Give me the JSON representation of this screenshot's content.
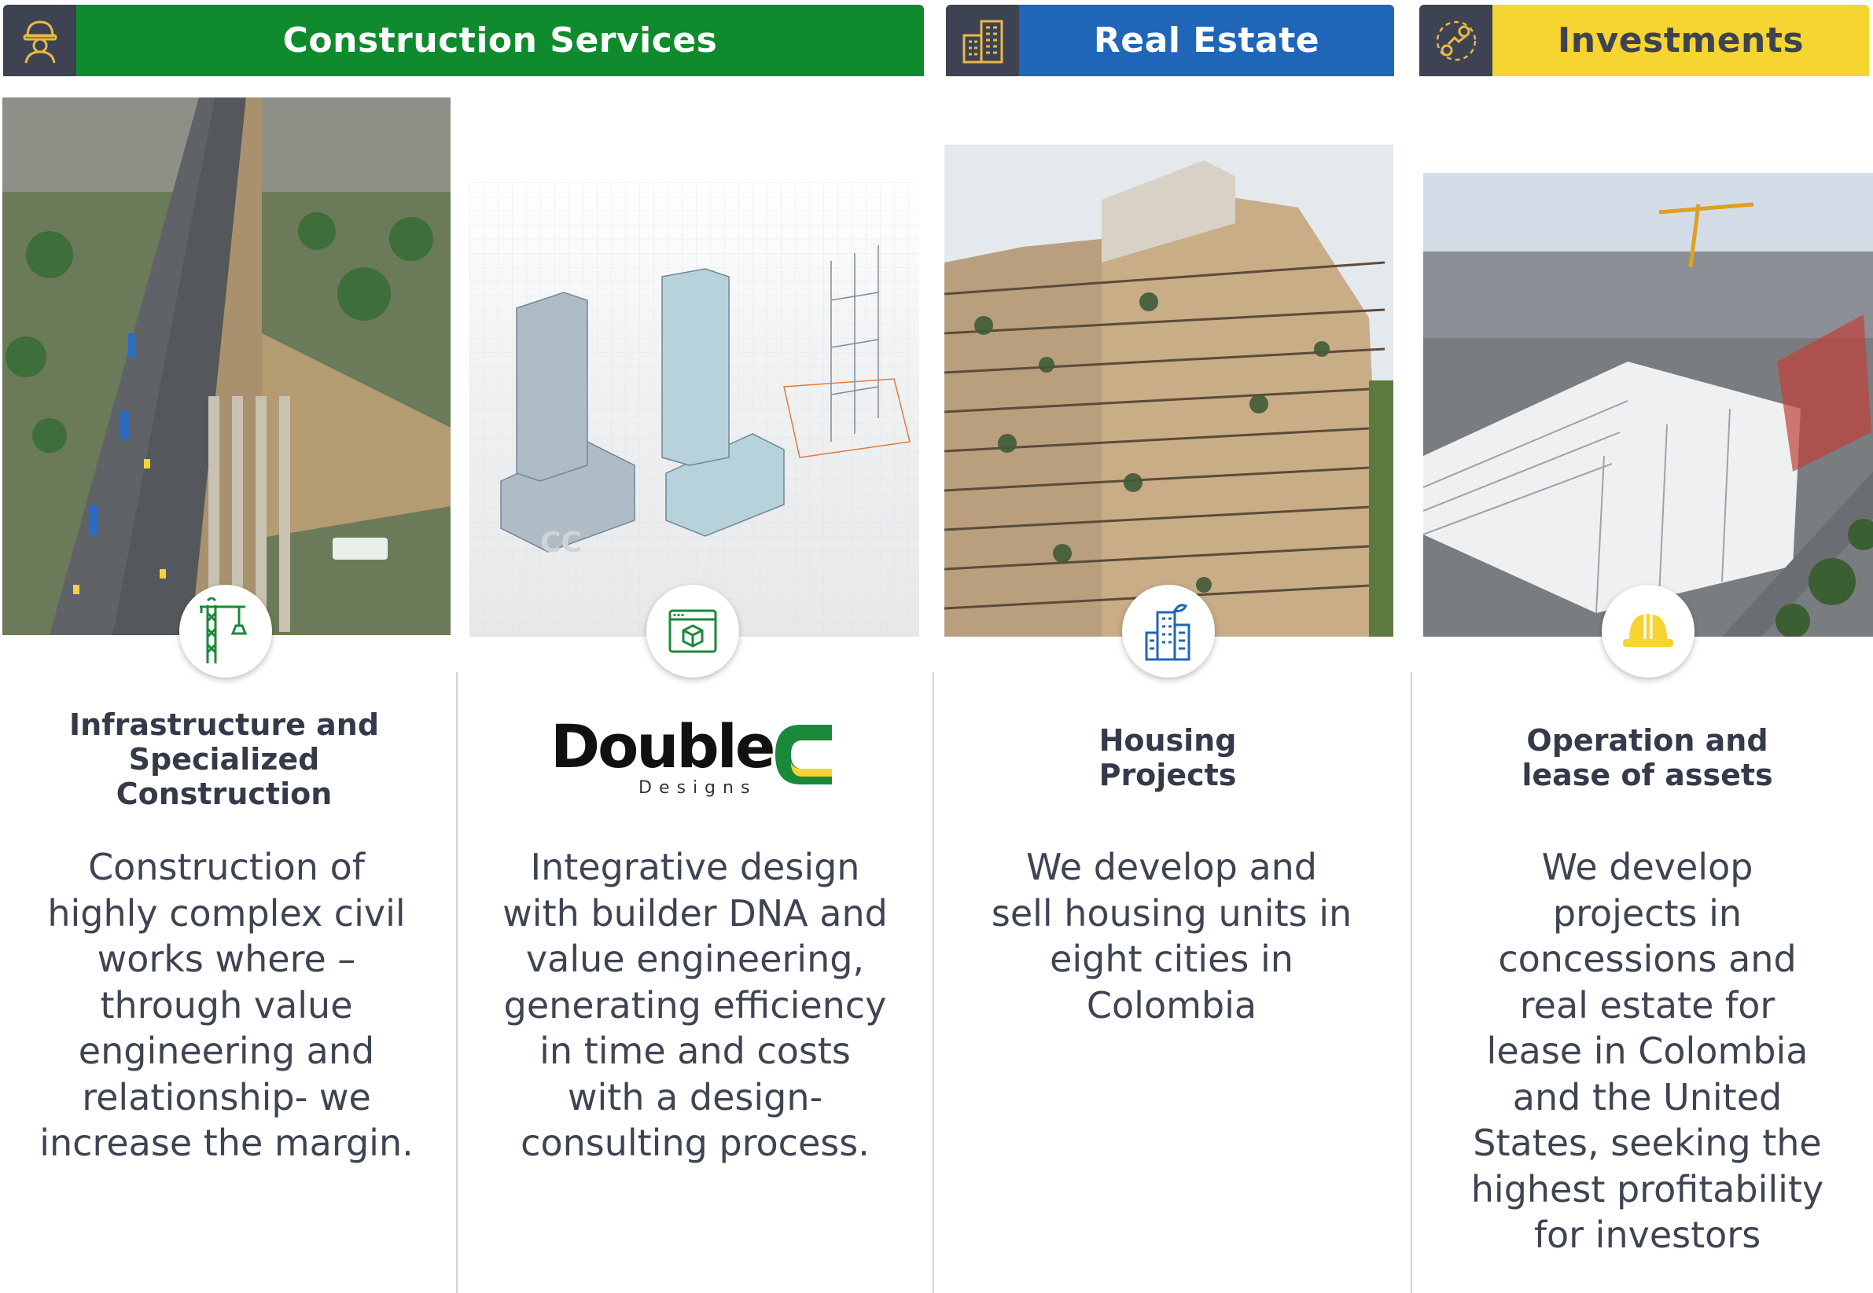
{
  "banners": {
    "construction": {
      "title": "Construction Services",
      "icon": "worker-icon",
      "color": "#0f8b2e"
    },
    "realestate": {
      "title": "Real Estate",
      "icon": "building-icon",
      "color": "#1f66b8"
    },
    "investments": {
      "title": "Investments",
      "icon": "growth-gears-icon",
      "color": "#f6d431"
    }
  },
  "columns": [
    {
      "heading": "Infrastructure and Specialized Construction",
      "description": "Construction of highly complex civil works where – through value engineering and relationship- we increase the margin.",
      "icon": "crane-icon"
    },
    {
      "logo_main": "Double",
      "logo_sub": "Designs",
      "description": "Integrative design with builder DNA and value engineering, generating efficiency in time and costs with a design-consulting process.",
      "icon": "design-window-icon"
    },
    {
      "heading": "Housing Projects",
      "description": "We develop and sell housing units in eight cities in Colombia",
      "icon": "city-buildings-icon"
    },
    {
      "heading": "Operation and lease of assets",
      "description": "We develop projects in concessions and real estate for lease in Colombia and the United States, seeking the highest profitability for investors",
      "icon": "hard-hat-icon"
    }
  ]
}
